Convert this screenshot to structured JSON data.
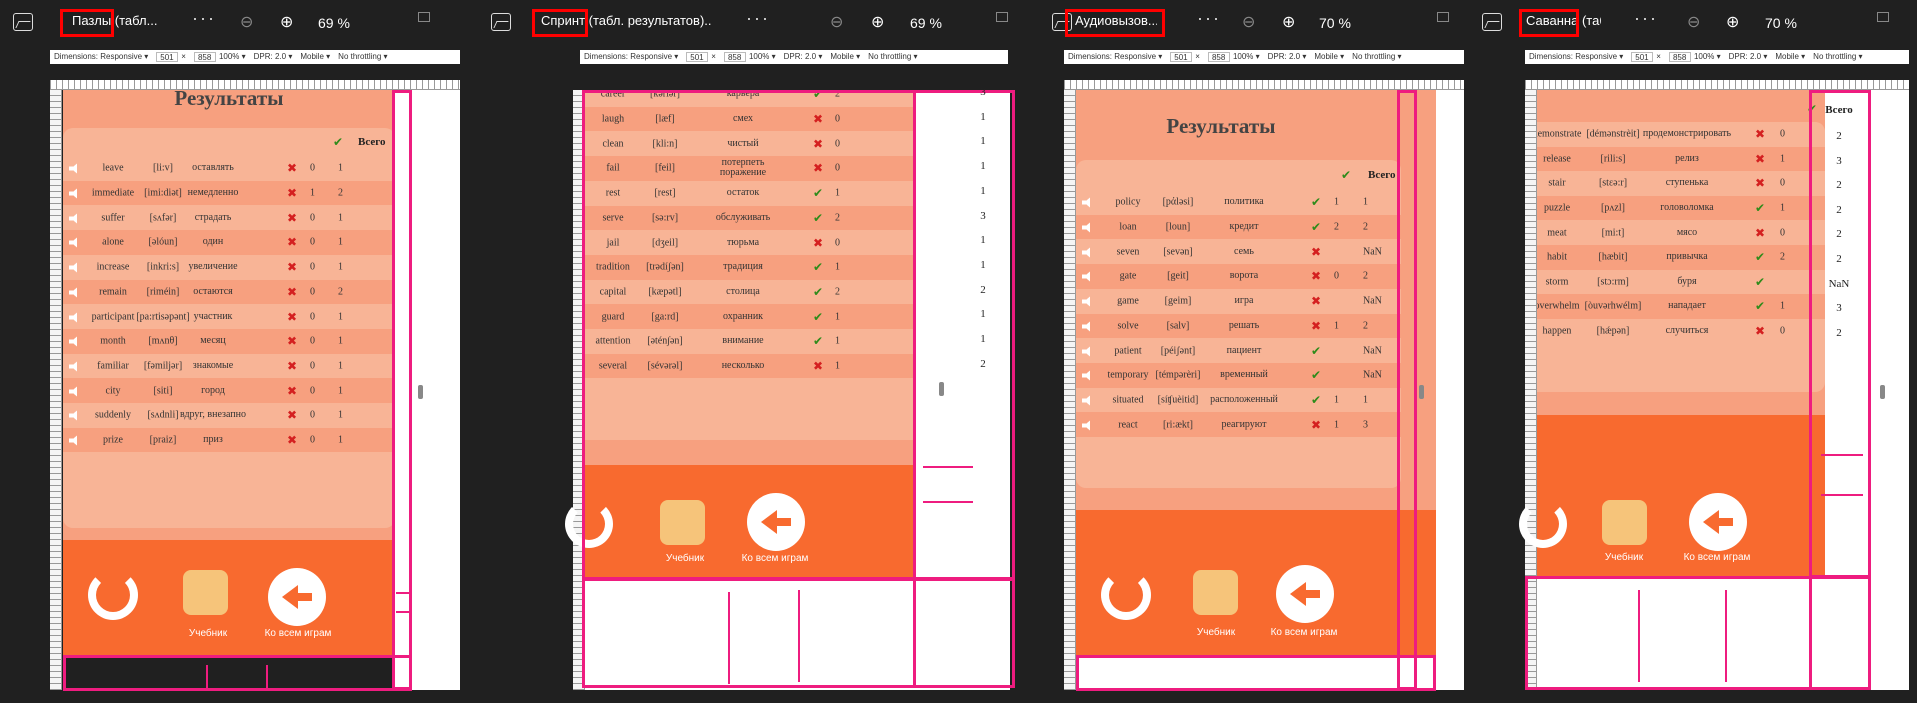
{
  "colors": {
    "accent": "#ee1c7f",
    "orange": "#f86a2f",
    "rowA": "#f8b496",
    "rowB": "#f7a07f",
    "correct": "#2e8b1a",
    "wrong": "#d42020"
  },
  "windows": [
    {
      "title": "Пазлы (табл...",
      "zoom": "69 %"
    },
    {
      "title": "Спринт (табл. результатов)...",
      "zoom": "69 %"
    },
    {
      "title": "Аудиовызов...",
      "zoom": "70 %"
    },
    {
      "title": "Саванна (таб...",
      "zoom": "70 %"
    }
  ],
  "devtools": {
    "dimensions": "Dimensions: Responsive ▾",
    "width": "501",
    "times": "×",
    "height": "858",
    "zoom": "100% ▾",
    "dpr": "DPR: 2.0 ▾",
    "mobile": "Mobile ▾",
    "throttle": "No throttling ▾"
  },
  "results_title": "Результаты",
  "col_total": "Всего",
  "textbook": "Учебник",
  "to_all_games": "Ко всем играм",
  "nan": "NaN",
  "w1_rows": [
    {
      "w": "leave",
      "t": "[li:v]",
      "r": "оставлять",
      "ok": false,
      "n": "0",
      "tot": "1"
    },
    {
      "w": "immediate",
      "t": "[imi:diət]",
      "r": "немедленно",
      "ok": false,
      "n": "1",
      "tot": "2"
    },
    {
      "w": "suffer",
      "t": "[sʌfər]",
      "r": "страдать",
      "ok": false,
      "n": "0",
      "tot": "1"
    },
    {
      "w": "alone",
      "t": "[əlóun]",
      "r": "один",
      "ok": false,
      "n": "0",
      "tot": "1"
    },
    {
      "w": "increase",
      "t": "[inkri:s]",
      "r": "увеличение",
      "ok": false,
      "n": "0",
      "tot": "1"
    },
    {
      "w": "remain",
      "t": "[riméin]",
      "r": "остаются",
      "ok": false,
      "n": "0",
      "tot": "2"
    },
    {
      "w": "participant",
      "t": "[pa:rtisəpənt]",
      "r": "участник",
      "ok": false,
      "n": "0",
      "tot": "1"
    },
    {
      "w": "month",
      "t": "[mʌnθ]",
      "r": "месяц",
      "ok": false,
      "n": "0",
      "tot": "1"
    },
    {
      "w": "familiar",
      "t": "[fəmiljər]",
      "r": "знакомые",
      "ok": false,
      "n": "0",
      "tot": "1"
    },
    {
      "w": "city",
      "t": "[siti]",
      "r": "город",
      "ok": false,
      "n": "0",
      "tot": "1"
    },
    {
      "w": "suddenly",
      "t": "[sʌdnli]",
      "r": "вдруг, внезапно",
      "ok": false,
      "n": "0",
      "tot": "1"
    },
    {
      "w": "prize",
      "t": "[praiz]",
      "r": "приз",
      "ok": false,
      "n": "0",
      "tot": "1"
    }
  ],
  "w2_rows": [
    {
      "w": "career",
      "t": "[kəríər]",
      "r": "карьера",
      "ok": true,
      "n": "2",
      "tot": "3"
    },
    {
      "w": "laugh",
      "t": "[læf]",
      "r": "смех",
      "ok": false,
      "n": "0",
      "tot": "1"
    },
    {
      "w": "clean",
      "t": "[kli:n]",
      "r": "чистый",
      "ok": false,
      "n": "0",
      "tot": "1"
    },
    {
      "w": "fail",
      "t": "[feil]",
      "r": "потерпеть поражение",
      "ok": false,
      "n": "0",
      "tot": "1"
    },
    {
      "w": "rest",
      "t": "[rest]",
      "r": "остаток",
      "ok": true,
      "n": "1",
      "tot": "1"
    },
    {
      "w": "serve",
      "t": "[sə:rv]",
      "r": "обслуживать",
      "ok": true,
      "n": "2",
      "tot": "3"
    },
    {
      "w": "jail",
      "t": "[dʒeil]",
      "r": "тюрьма",
      "ok": false,
      "n": "0",
      "tot": "1"
    },
    {
      "w": "tradition",
      "t": "[trədíʃən]",
      "r": "традиция",
      "ok": true,
      "n": "1",
      "tot": "1"
    },
    {
      "w": "capital",
      "t": "[kæpətl]",
      "r": "столица",
      "ok": true,
      "n": "2",
      "tot": "2"
    },
    {
      "w": "guard",
      "t": "[ga:rd]",
      "r": "охранник",
      "ok": true,
      "n": "1",
      "tot": "1"
    },
    {
      "w": "attention",
      "t": "[ətén∫ən]",
      "r": "внимание",
      "ok": true,
      "n": "1",
      "tot": "1"
    },
    {
      "w": "several",
      "t": "[sévərəl]",
      "r": "несколько",
      "ok": false,
      "n": "1",
      "tot": "2"
    }
  ],
  "w3_rows": [
    {
      "w": "policy",
      "t": "[pάləsi]",
      "r": "политика",
      "ok": true,
      "n": "1",
      "tot": "1"
    },
    {
      "w": "loan",
      "t": "[loun]",
      "r": "кредит",
      "ok": true,
      "n": "2",
      "tot": "2"
    },
    {
      "w": "seven",
      "t": "[sevən]",
      "r": "семь",
      "ok": false,
      "n": "",
      "tot": "NaN"
    },
    {
      "w": "gate",
      "t": "[geit]",
      "r": "ворота",
      "ok": false,
      "n": "0",
      "tot": "2"
    },
    {
      "w": "game",
      "t": "[geim]",
      "r": "игра",
      "ok": false,
      "n": "",
      "tot": "NaN"
    },
    {
      "w": "solve",
      "t": "[salv]",
      "r": "решать",
      "ok": false,
      "n": "1",
      "tot": "2"
    },
    {
      "w": "patient",
      "t": "[péiʃənt]",
      "r": "пациент",
      "ok": true,
      "n": "",
      "tot": "NaN"
    },
    {
      "w": "temporary",
      "t": "[témpərèri]",
      "r": "временный",
      "ok": true,
      "n": "",
      "tot": "NaN"
    },
    {
      "w": "situated",
      "t": "[síʧuèitid]",
      "r": "расположенный",
      "ok": true,
      "n": "1",
      "tot": "1"
    },
    {
      "w": "react",
      "t": "[ri:ækt]",
      "r": "реагируют",
      "ok": false,
      "n": "1",
      "tot": "3"
    }
  ],
  "w4_rows": [
    {
      "w": "demonstrate",
      "t": "[démənstrèit]",
      "r": "продемонстрировать",
      "ok": false,
      "n": "0",
      "tot": "2"
    },
    {
      "w": "release",
      "t": "[rili:s]",
      "r": "релиз",
      "ok": false,
      "n": "1",
      "tot": "3"
    },
    {
      "w": "stair",
      "t": "[stɛə:r]",
      "r": "ступенька",
      "ok": false,
      "n": "0",
      "tot": "2"
    },
    {
      "w": "puzzle",
      "t": "[pʌzl]",
      "r": "головоломка",
      "ok": true,
      "n": "1",
      "tot": "2"
    },
    {
      "w": "meat",
      "t": "[mi:t]",
      "r": "мясо",
      "ok": false,
      "n": "0",
      "tot": "2"
    },
    {
      "w": "habit",
      "t": "[hæbit]",
      "r": "привычка",
      "ok": true,
      "n": "2",
      "tot": "2"
    },
    {
      "w": "storm",
      "t": "[stɔ:rm]",
      "r": "буря",
      "ok": true,
      "n": "",
      "tot": "NaN"
    },
    {
      "w": "overwhelm",
      "t": "[òuvərhwélm]",
      "r": "нападает",
      "ok": true,
      "n": "1",
      "tot": "3"
    },
    {
      "w": "happen",
      "t": "[hǽpən]",
      "r": "случиться",
      "ok": false,
      "n": "0",
      "tot": "2"
    }
  ]
}
